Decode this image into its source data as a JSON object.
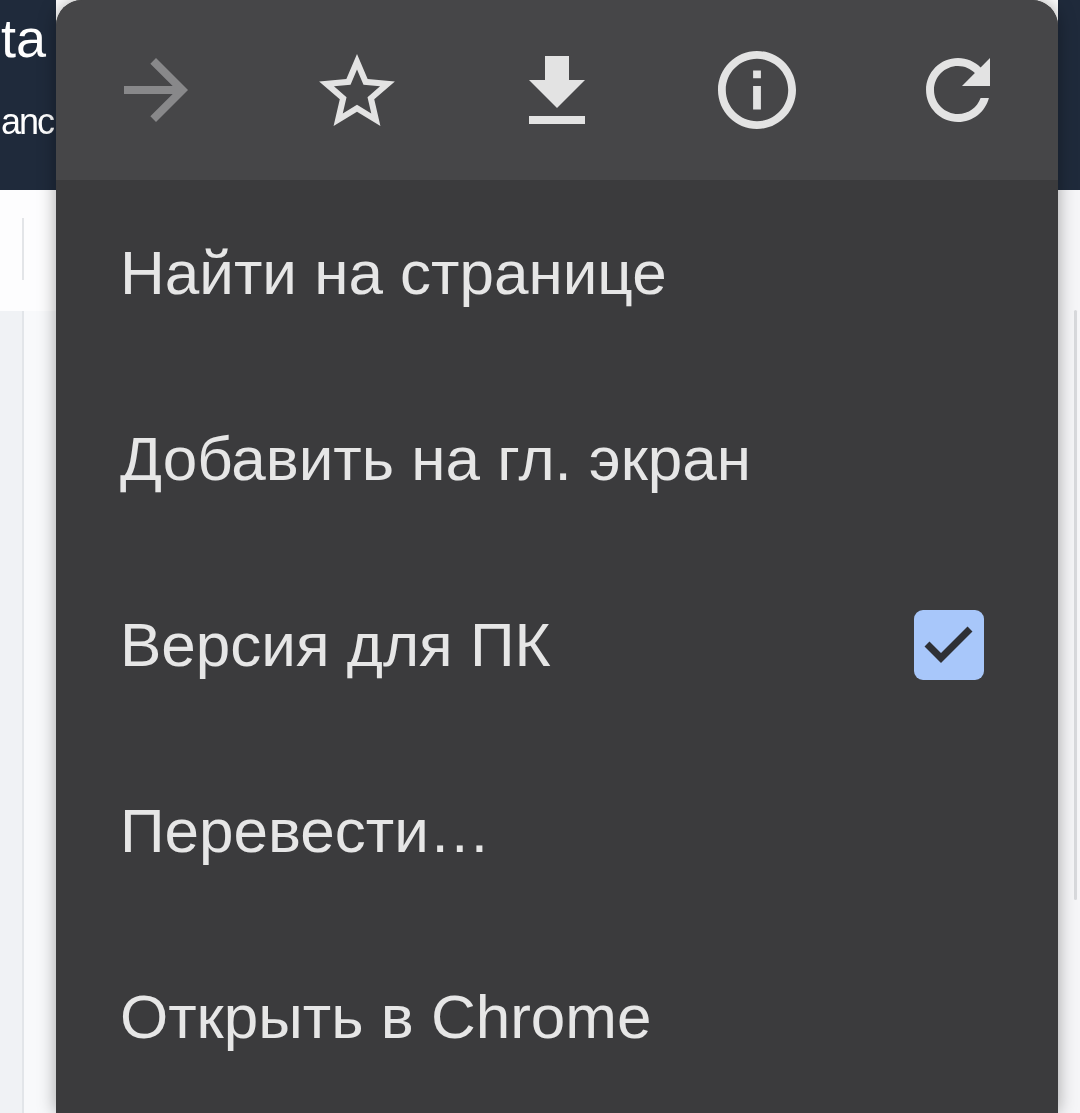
{
  "page": {
    "header_title": "ta",
    "header_subtitle": "anc"
  },
  "menu": {
    "toolbar": [
      {
        "disabled": true
      },
      {
        "disabled": false
      },
      {
        "disabled": false
      },
      {
        "disabled": false
      },
      {
        "disabled": false
      }
    ],
    "items": [
      {
        "kind": "action",
        "label": "Найти на странице"
      },
      {
        "kind": "action",
        "label": "Добавить на гл. экран"
      },
      {
        "kind": "checkbox",
        "label": "Версия для ПК",
        "checked": true
      },
      {
        "kind": "action",
        "label": "Перевести…"
      },
      {
        "kind": "action",
        "label": "Открыть в Chrome"
      }
    ]
  }
}
